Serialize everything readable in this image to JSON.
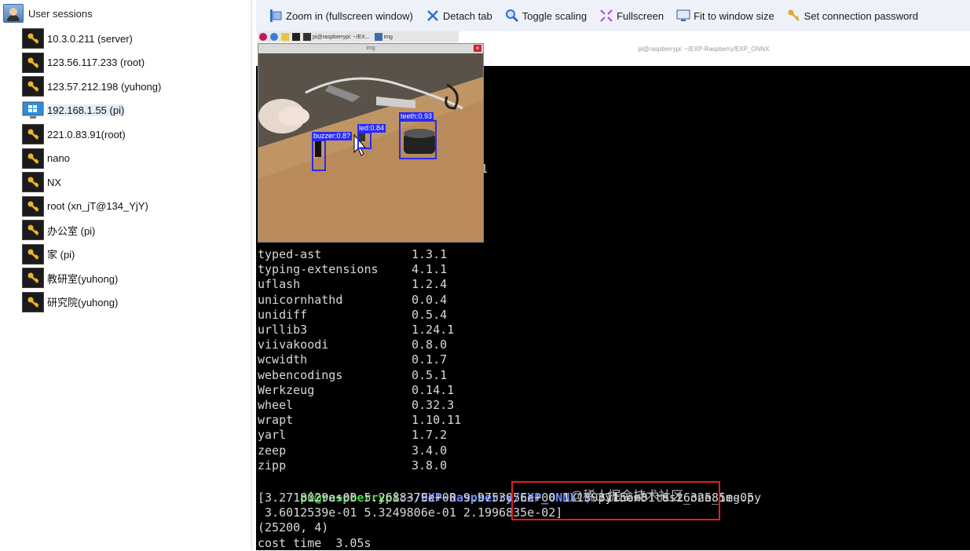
{
  "sessions": {
    "header": "User sessions",
    "items": [
      {
        "label": "10.3.0.211 (server)",
        "icon": "key-icon"
      },
      {
        "label": "123.56.117.233 (root)",
        "icon": "key-icon"
      },
      {
        "label": "123.57.212.198 (yuhong)",
        "icon": "key-icon"
      },
      {
        "label": "192.168.1.55 (pi)",
        "icon": "windows-monitor-icon",
        "selected": true
      },
      {
        "label": "221.0.83.91(root)",
        "icon": "key-icon"
      },
      {
        "label": "nano",
        "icon": "key-icon"
      },
      {
        "label": "NX",
        "icon": "key-icon"
      },
      {
        "label": "root (xn_jT@134_YjY)",
        "icon": "key-icon"
      },
      {
        "label": "办公室 (pi)",
        "icon": "key-icon"
      },
      {
        "label": "家 (pi)",
        "icon": "key-icon"
      },
      {
        "label": "教研室(yuhong)",
        "icon": "key-icon"
      },
      {
        "label": "研究院(yuhong)",
        "icon": "key-icon"
      }
    ]
  },
  "toolbar": {
    "zoom_in": "Zoom in (fullscreen window)",
    "detach": "Detach tab",
    "toggle_scaling": "Toggle scaling",
    "fullscreen": "Fullscreen",
    "fit": "Fit to window size",
    "set_password": "Set connection password"
  },
  "remote": {
    "taskbar": {
      "terminal_item": "pi@raspberrypi: ~/EX...",
      "img_item": "img"
    },
    "window_title": "pi@raspberrypi: ~/EXP-Raspberry/EXP_ONNX",
    "img_window_title": "img",
    "detections": [
      {
        "label": "buzzer:0.8?",
        "color": "#2a2af5"
      },
      {
        "label": "led:0.84",
        "color": "#2a2af5"
      },
      {
        "label": "teeth:0.93",
        "color": "#2a2af5"
      }
    ],
    "stray_char": "1"
  },
  "terminal": {
    "packages": [
      {
        "name": "typed-ast",
        "version": "1.3.1"
      },
      {
        "name": "typing-extensions",
        "version": "4.1.1"
      },
      {
        "name": "uflash",
        "version": "1.2.4"
      },
      {
        "name": "unicornhathd",
        "version": "0.0.4"
      },
      {
        "name": "unidiff",
        "version": "0.5.4"
      },
      {
        "name": "urllib3",
        "version": "1.24.1"
      },
      {
        "name": "viivakoodi",
        "version": "0.8.0"
      },
      {
        "name": "wcwidth",
        "version": "0.1.7"
      },
      {
        "name": "webencodings",
        "version": "0.5.1"
      },
      {
        "name": "Werkzeug",
        "version": "0.14.1"
      },
      {
        "name": "wheel",
        "version": "0.32.3"
      },
      {
        "name": "wrapt",
        "version": "1.10.11"
      },
      {
        "name": "yarl",
        "version": "1.7.2"
      },
      {
        "name": "zeep",
        "version": "3.4.0"
      },
      {
        "name": "zipp",
        "version": "3.8.0"
      }
    ],
    "prompt_user": "pi@raspberrypi",
    "prompt_path": ":~/EXP-Raspberry/EXP_ONNX $",
    "command": " python3 test_one_img.py",
    "output": [
      "[3.2718029e+00 5.2688379e+00 9.9753056e+00 1.1393115e+01 8.2632585e-05",
      " 3.6012539e-01 5.3249806e-01 2.1996835e-02]",
      "(25200, 4)",
      "cost time  3.05s"
    ],
    "highlight_color": "#e02020"
  },
  "watermark": "@稀土掘金技术社区"
}
